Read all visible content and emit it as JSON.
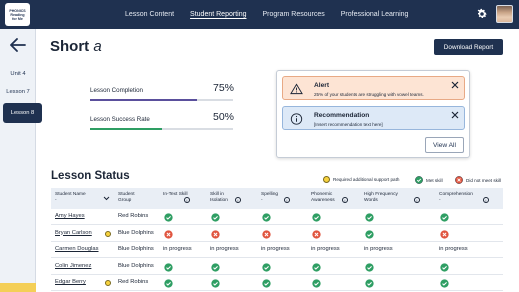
{
  "app": {
    "logo_lines": [
      "PHONICS",
      "Reading",
      "for Me"
    ]
  },
  "nav": {
    "items": [
      "Lesson Content",
      "Student Reporting",
      "Program Resources",
      "Professional Learning"
    ],
    "active_index": 1
  },
  "sidebar": {
    "items": [
      "Unit 4",
      "Lesson 7",
      "Lesson 8"
    ],
    "active_index": 2
  },
  "page": {
    "title_main": "Short",
    "title_letter": "a",
    "download_label": "Download Report"
  },
  "metrics": [
    {
      "label": "Lesson Completion",
      "value": "75%",
      "fraction": 0.75,
      "color": "#5a4f9c"
    },
    {
      "label": "Lesson Success Rate",
      "value": "50%",
      "fraction": 0.5,
      "color": "#2e9e63"
    }
  ],
  "notifications": {
    "alert": {
      "title": "Alert",
      "body": "25% of your students are struggling with vowel teams.",
      "bg": "#fde4d4",
      "icon": "warning-icon"
    },
    "recommendation": {
      "title": "Recommendation",
      "body": "[Insert recommendation text here]",
      "bg": "#dde9f7",
      "icon": "info-icon"
    },
    "view_all_label": "View All"
  },
  "lesson_status": {
    "title": "Lesson Status",
    "legend": {
      "support": "Required additional support path",
      "met": "Met skill",
      "not_met": "Did not meet skill"
    },
    "columns": [
      "Student Name",
      "Student Group",
      "In-Text Skill",
      "Skill in Isolation",
      "Spelling",
      "Phonemic Awareness",
      "High Frequency Words",
      "Comprehension"
    ],
    "rows": [
      {
        "name": "Amy Hayes",
        "support": false,
        "group": "Red Robins",
        "cells": [
          "met",
          "met",
          "met",
          "met",
          "met",
          "met"
        ]
      },
      {
        "name": "Bryan Carlson",
        "support": true,
        "group": "Blue Dolphins",
        "cells": [
          "not_met",
          "not_met",
          "not_met",
          "not_met",
          "met",
          "not_met"
        ]
      },
      {
        "name": "Carmen Douglas",
        "support": false,
        "group": "Blue Dolphins",
        "cells": [
          "in progress",
          "in progress",
          "in progress",
          "in progress",
          "in progress",
          "in progress"
        ]
      },
      {
        "name": "Colin Jimenez",
        "support": false,
        "group": "Blue Dolphins",
        "cells": [
          "met",
          "met",
          "met",
          "met",
          "met",
          "met"
        ]
      },
      {
        "name": "Edgar Berry",
        "support": true,
        "group": "Red Robins",
        "cells": [
          "met",
          "met",
          "met",
          "met",
          "met",
          "met"
        ]
      }
    ]
  },
  "colors": {
    "navy": "#1f3150",
    "met": "#2e9e63",
    "not_met": "#e0553f",
    "support": "#f7d23e"
  }
}
